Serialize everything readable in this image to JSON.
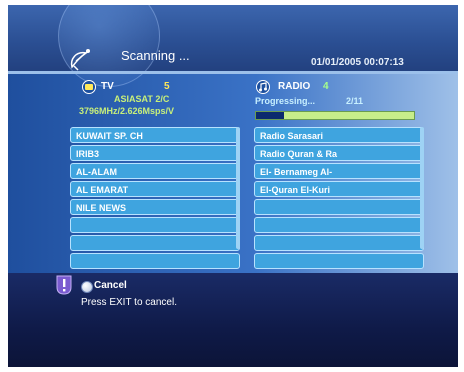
{
  "header": {
    "title": "Scanning ...",
    "datetime": "01/01/2005 00:07:13"
  },
  "tv": {
    "label": "TV",
    "count": "5",
    "satellite": "ASIASAT 2/C",
    "frequency": "3796MHz/2.626Msps/V",
    "channels": [
      "KUWAIT SP. CH",
      "IRIB3",
      "AL-ALAM",
      "AL EMARAT",
      "NILE NEWS",
      "",
      "",
      ""
    ]
  },
  "radio": {
    "label": "RADIO",
    "count": "4",
    "progress_label": "Progressing...",
    "progress_value": "2/11",
    "progress_fraction": 0.18,
    "channels": [
      "Radio Sarasari",
      "Radio Quran & Ra",
      "El- Bernameg Al-",
      "El-Quran El-Kuri",
      "",
      "",
      "",
      ""
    ]
  },
  "footer": {
    "cancel_label": "Cancel",
    "hint": "Press EXIT to cancel."
  },
  "colors": {
    "accent_yellow": "#ffe85a",
    "accent_green": "#c8f07a",
    "row_blue": "#3fa4df"
  }
}
